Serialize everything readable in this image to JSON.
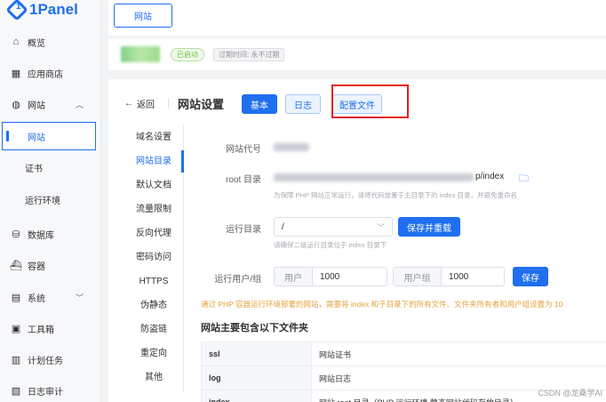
{
  "app": {
    "logo_text": "1Panel"
  },
  "sidebar": {
    "items": [
      {
        "label": "概览",
        "icon": "home-icon"
      },
      {
        "label": "应用商店",
        "icon": "grid-icon"
      },
      {
        "label": "网站",
        "icon": "globe-icon",
        "expanded": true
      },
      {
        "label": "网站",
        "sub": true,
        "active": true
      },
      {
        "label": "证书",
        "sub": true
      },
      {
        "label": "运行环境",
        "sub": true
      },
      {
        "label": "数据库",
        "icon": "database-icon"
      },
      {
        "label": "容器",
        "icon": "container-icon"
      },
      {
        "label": "系统",
        "icon": "system-icon"
      },
      {
        "label": "工具箱",
        "icon": "toolbox-icon"
      },
      {
        "label": "计划任务",
        "icon": "calendar-icon"
      },
      {
        "label": "日志审计",
        "icon": "log-icon"
      }
    ]
  },
  "tabbar": {
    "active_tab": "网站"
  },
  "header": {
    "status": "已启动",
    "expiry": "过期时间: 永不过期"
  },
  "main": {
    "back_label": "返回",
    "title": "网站设置",
    "tabs": {
      "basic": "基本",
      "log": "日志",
      "config": "配置文件"
    },
    "submenu": [
      "域名设置",
      "网站目录",
      "默认文档",
      "流量限制",
      "反向代理",
      "密码访问",
      "HTTPS",
      "伪静态",
      "防盗链",
      "重定向",
      "其他"
    ],
    "form": {
      "code_label": "网站代号",
      "root_label": "root 目录",
      "root_suffix": "p/index",
      "root_hint": "为保障 PHP 网站正常运行，请将代码放置于主目录下的 index 目录，并避免重命名",
      "run_dir_label": "运行目录",
      "run_dir_value": "/",
      "run_dir_hint": "请确保二级运行目录位于 index 目录下",
      "save_reload_btn": "保存并重载",
      "run_user_label": "运行用户/组",
      "user_addon": "用户",
      "user_value": "1000",
      "group_addon": "用户组",
      "group_value": "1000",
      "save_btn": "保存"
    },
    "warning": "通过 PHP 容器运行环境部署的网站，需要将 index 和子目录下的所有文件、文件夹所有者和用户组设置为 10",
    "section_title": "网站主要包含以下文件夹",
    "files": [
      {
        "name": "ssl",
        "desc": "网站证书"
      },
      {
        "name": "log",
        "desc": "网站日志"
      },
      {
        "name": "index",
        "desc": "网站 root 目录（PHP 运行环境 静态网站代码存放目录）"
      }
    ]
  },
  "watermark": "CSDN @龙桑学AI",
  "colors": {
    "primary": "#1f6ff0",
    "success": "#67c23a",
    "warning": "#e6a23c",
    "highlight": "#e21e1e"
  }
}
